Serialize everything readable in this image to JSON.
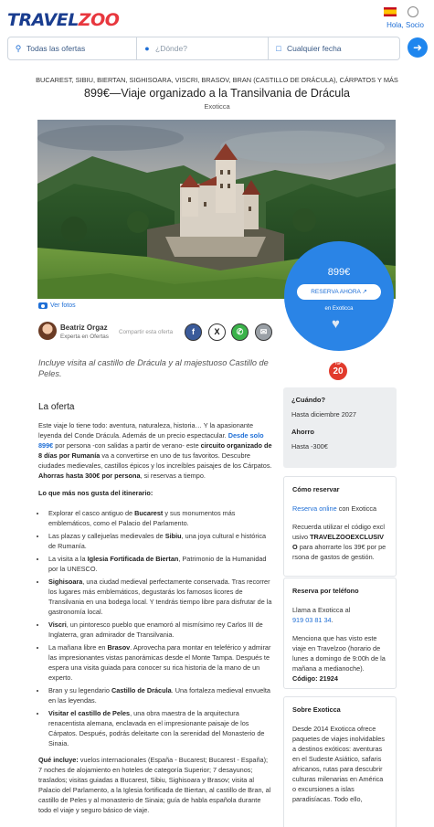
{
  "header": {
    "logo_part1": "TRAVEL",
    "logo_part2": "ZOO",
    "greeting": "Hola, Socio"
  },
  "search": {
    "offers_label": "Todas las ofertas",
    "where_placeholder": "¿Dónde?",
    "date_label": "Cualquier fecha",
    "icons": {
      "offers": "search-icon",
      "where": "map-pin-icon",
      "date": "calendar-icon",
      "go": "arrow-right-icon"
    }
  },
  "deal": {
    "locations": "BUCAREST, SIBIU, BIERTAN, SIGHISOARA, VISCRI, BRASOV, BRAN (CASTILLO DE DRÁCULA), CÁRPATOS Y MÁS",
    "title": "899€—Viaje organizado a la Transilvania de Drácula",
    "provider": "Exoticca",
    "photo_caption": "Ver fotos",
    "subtitle": "Incluye visita al castillo de Drácula y al majestuoso Castillo de Peles."
  },
  "price_box": {
    "price": "899€",
    "cta": "RESERVA AHORA ↗",
    "on": "en Exoticca"
  },
  "author": {
    "name": "Beatriz Orgaz",
    "role": "Experta en Ofertas",
    "share_label": "Compartir esta oferta",
    "share_icons": [
      "facebook-icon",
      "x-icon",
      "whatsapp-icon",
      "email-icon"
    ]
  },
  "badge": {
    "top": "TOP",
    "num": "20"
  },
  "offer": {
    "heading": "La oferta",
    "p1_a": "Este viaje lo tiene todo: aventura, naturaleza, historia… Y la apasionante leyenda del Conde Drácula. Además de un precio espectacular. ",
    "p1_b": "Desde solo 899€",
    "p1_c": " por persona -con salidas a partir de verano- este ",
    "p1_d": "circuito organizado de 8 días por Rumanía",
    "p1_e": " va a convertirse en uno de tus favoritos. Descubre ciudades medievales, castillos épicos y los increíbles paisajes de los Cárpatos. ",
    "p1_f": "Ahorras hasta 300€ por persona",
    "p1_g": ", si reservas a tiempo.",
    "likes_heading": "Lo que más nos gusta del itinerario:",
    "items": [
      {
        "a": "Explorar el casco antiguo de ",
        "b": "Bucarest",
        "c": " y sus monumentos más emblemáticos, como el Palacio del Parlamento."
      },
      {
        "a": "Las plazas y callejuelas medievales de ",
        "b": "Sibiu",
        "c": ", una joya cultural e histórica de Rumanía."
      },
      {
        "a": "La visita a la ",
        "b": "Iglesia Fortificada de Biertan",
        "c": ", Patrimonio de la Humanidad por la UNESCO."
      },
      {
        "a": "",
        "b": "Sighisoara",
        "c": ", una ciudad medieval perfectamente conservada. Tras recorrer los lugares más emblemáticos, degustarás los famosos licores de Transilvania en una bodega local. Y tendrás tiempo libre para disfrutar de la gastronomía local."
      },
      {
        "a": "",
        "b": "Viscri",
        "c": ", un pintoresco pueblo que enamoró al mismísimo rey Carlos III de Inglaterra, gran admirador de Transilvania."
      },
      {
        "a": "La mañana libre en ",
        "b": "Brasov",
        "c": ". Aprovecha para montar en teleférico y admirar las impresionantes vistas panorámicas desde el Monte Tampa. Después te espera una visita guiada para conocer su rica historia de la mano de un experto."
      },
      {
        "a": "Bran y su legendario ",
        "b": "Castillo de Drácula",
        "c": ". Una fortaleza medieval envuelta en las leyendas."
      },
      {
        "a": "",
        "b": "Visitar el castillo de Peles",
        "c": ", una obra maestra de la arquitectura renacentista alemana, enclavada en el impresionante paisaje de los Cárpatos. Después, podrás deleitarte con la serenidad del Monasterio de Sinaia."
      }
    ],
    "includes_label": "Qué incluye:",
    "includes_text": " vuelos internacionales (España - Bucarest; Bucarest - España); 7 noches de alojamiento en hoteles de categoría Superior; 7 desayunos; traslados; visitas guiadas a Bucarest, Sibiu, Sighisoara y Brasov; visita al Palacio del Parlamento, a la Iglesia fortificada de Biertan, al castillo de Bran, al castillo de Peles y al monasterio de Sinaia; guía de habla española durante todo el viaje y seguro básico de viaje."
  },
  "when": {
    "label": "¿Cuándo?",
    "value": "Hasta diciembre 2027",
    "savings_label": "Ahorro",
    "savings_value": "Hasta -300€"
  },
  "how_to_book": {
    "heading": "Cómo reservar",
    "line_link": "Reserva online",
    "line_rest": " con Exoticca",
    "p2_a": "Recuerda utilizar el código exclusivo ",
    "p2_code": "TRAVELZOOEXCLUSIVO",
    "p2_c": " para ahorrarte los 39€ por persona de gastos de gestión."
  },
  "phone_booking": {
    "heading": "Reserva por teléfono",
    "line": "Llama a Exoticca al",
    "phone": "919 03 81 34",
    "phone_suffix": ".",
    "p2": "Menciona que has visto este viaje en Travelzoo (horario de lunes a domingo de 9:00h de la mañana a medianoche). ",
    "code_label": "Código: 21924"
  },
  "about": {
    "heading": "Sobre Exoticca",
    "text": "Desde 2014 Exoticca ofrece paquetes de viajes inolvidables a destinos exóticos: aventuras en el Sudeste Asiático, safaris africanos, rutas para descubrir culturas milenarias en América o excursiones a islas paradisíacas. Todo ello,"
  }
}
